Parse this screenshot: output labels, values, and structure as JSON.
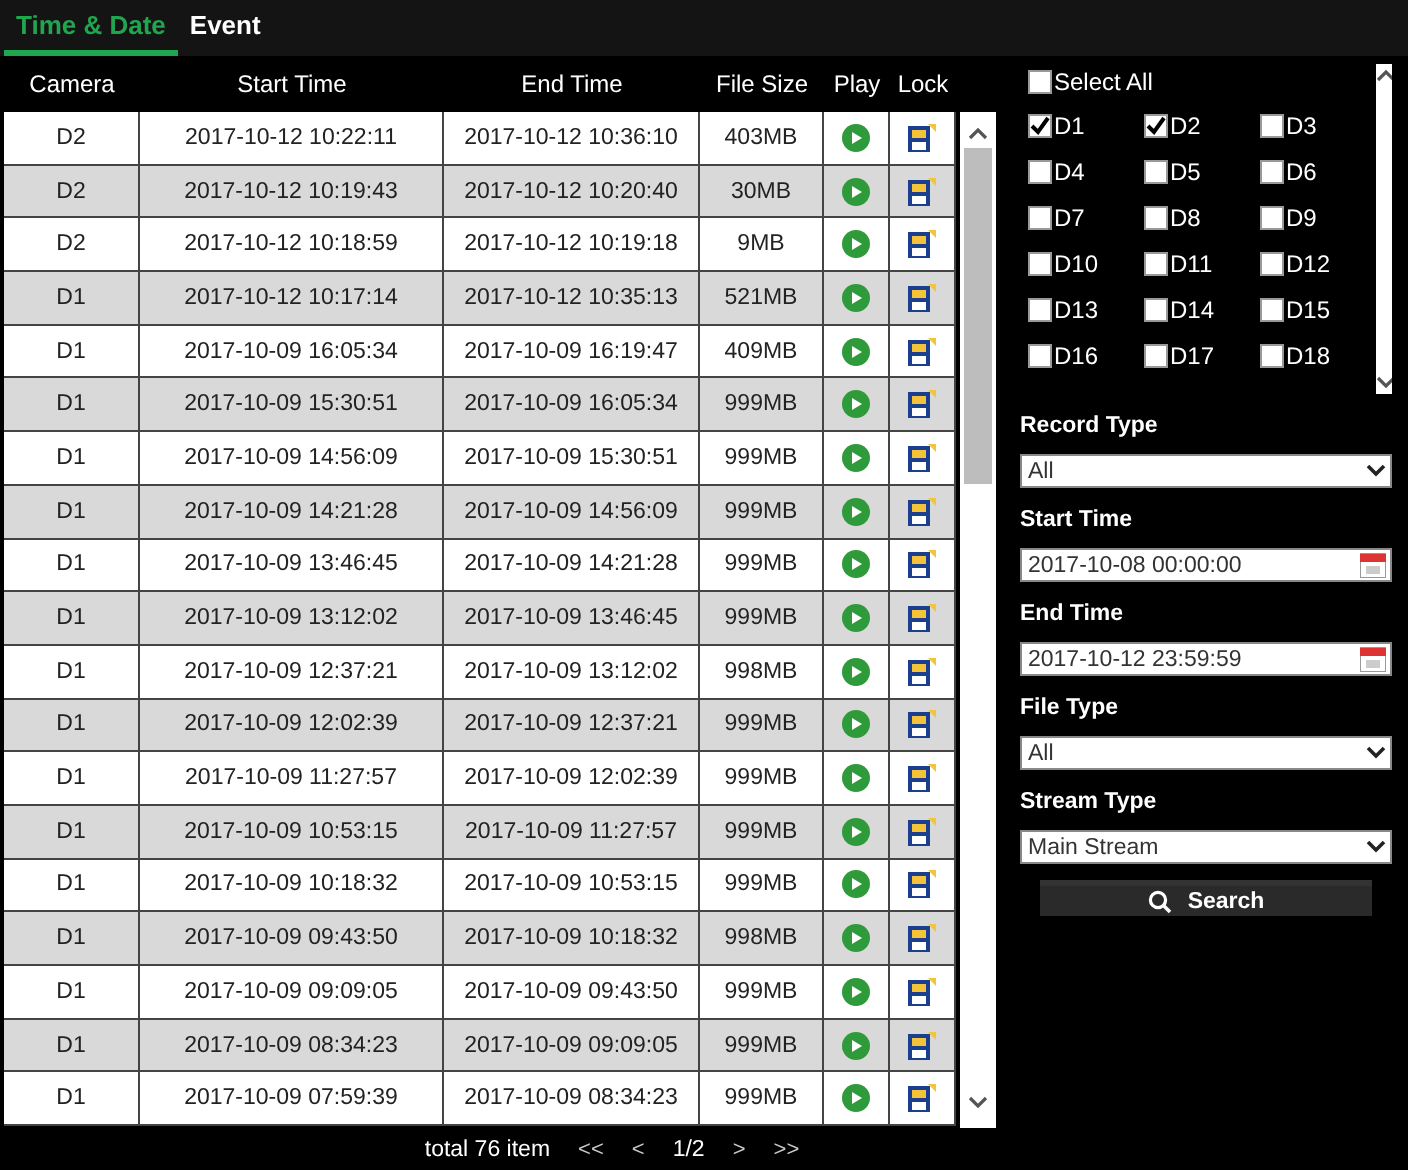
{
  "tabs": [
    {
      "label": "Time & Date",
      "selected": true
    },
    {
      "label": "Event",
      "selected": false
    }
  ],
  "table": {
    "columns": [
      "Camera",
      "Start Time",
      "End Time",
      "File Size",
      "Play",
      "Lock"
    ],
    "rows": [
      {
        "camera": "D2",
        "start": "2017-10-12 10:22:11",
        "end": "2017-10-12 10:36:10",
        "size": "403MB"
      },
      {
        "camera": "D2",
        "start": "2017-10-12 10:19:43",
        "end": "2017-10-12 10:20:40",
        "size": "30MB"
      },
      {
        "camera": "D2",
        "start": "2017-10-12 10:18:59",
        "end": "2017-10-12 10:19:18",
        "size": "9MB"
      },
      {
        "camera": "D1",
        "start": "2017-10-12 10:17:14",
        "end": "2017-10-12 10:35:13",
        "size": "521MB"
      },
      {
        "camera": "D1",
        "start": "2017-10-09 16:05:34",
        "end": "2017-10-09 16:19:47",
        "size": "409MB"
      },
      {
        "camera": "D1",
        "start": "2017-10-09 15:30:51",
        "end": "2017-10-09 16:05:34",
        "size": "999MB"
      },
      {
        "camera": "D1",
        "start": "2017-10-09 14:56:09",
        "end": "2017-10-09 15:30:51",
        "size": "999MB"
      },
      {
        "camera": "D1",
        "start": "2017-10-09 14:21:28",
        "end": "2017-10-09 14:56:09",
        "size": "999MB"
      },
      {
        "camera": "D1",
        "start": "2017-10-09 13:46:45",
        "end": "2017-10-09 14:21:28",
        "size": "999MB"
      },
      {
        "camera": "D1",
        "start": "2017-10-09 13:12:02",
        "end": "2017-10-09 13:46:45",
        "size": "999MB"
      },
      {
        "camera": "D1",
        "start": "2017-10-09 12:37:21",
        "end": "2017-10-09 13:12:02",
        "size": "998MB"
      },
      {
        "camera": "D1",
        "start": "2017-10-09 12:02:39",
        "end": "2017-10-09 12:37:21",
        "size": "999MB"
      },
      {
        "camera": "D1",
        "start": "2017-10-09 11:27:57",
        "end": "2017-10-09 12:02:39",
        "size": "999MB"
      },
      {
        "camera": "D1",
        "start": "2017-10-09 10:53:15",
        "end": "2017-10-09 11:27:57",
        "size": "999MB"
      },
      {
        "camera": "D1",
        "start": "2017-10-09 10:18:32",
        "end": "2017-10-09 10:53:15",
        "size": "999MB"
      },
      {
        "camera": "D1",
        "start": "2017-10-09 09:43:50",
        "end": "2017-10-09 10:18:32",
        "size": "998MB"
      },
      {
        "camera": "D1",
        "start": "2017-10-09 09:09:05",
        "end": "2017-10-09 09:43:50",
        "size": "999MB"
      },
      {
        "camera": "D1",
        "start": "2017-10-09 08:34:23",
        "end": "2017-10-09 09:09:05",
        "size": "999MB"
      },
      {
        "camera": "D1",
        "start": "2017-10-09 07:59:39",
        "end": "2017-10-09 08:34:23",
        "size": "999MB"
      }
    ]
  },
  "pagination": {
    "total": "total 76 item",
    "first": "<<",
    "prev": "<",
    "page": "1/2",
    "next": ">",
    "last": ">>"
  },
  "channels": {
    "select_all": {
      "label": "Select All",
      "checked": false
    },
    "items": [
      {
        "label": "D1",
        "checked": true
      },
      {
        "label": "D2",
        "checked": true
      },
      {
        "label": "D3",
        "checked": false
      },
      {
        "label": "D4",
        "checked": false
      },
      {
        "label": "D5",
        "checked": false
      },
      {
        "label": "D6",
        "checked": false
      },
      {
        "label": "D7",
        "checked": false
      },
      {
        "label": "D8",
        "checked": false
      },
      {
        "label": "D9",
        "checked": false
      },
      {
        "label": "D10",
        "checked": false
      },
      {
        "label": "D11",
        "checked": false
      },
      {
        "label": "D12",
        "checked": false
      },
      {
        "label": "D13",
        "checked": false
      },
      {
        "label": "D14",
        "checked": false
      },
      {
        "label": "D15",
        "checked": false
      },
      {
        "label": "D16",
        "checked": false
      },
      {
        "label": "D17",
        "checked": false
      },
      {
        "label": "D18",
        "checked": false
      }
    ]
  },
  "filters": [
    {
      "kind": "select",
      "label": "Record Type",
      "value": "All"
    },
    {
      "kind": "date",
      "label": "Start Time",
      "value": "2017-10-08 00:00:00"
    },
    {
      "kind": "date",
      "label": "End Time",
      "value": "2017-10-12 23:59:59"
    },
    {
      "kind": "select",
      "label": "File Type",
      "value": "All"
    },
    {
      "kind": "select",
      "label": "Stream Type",
      "value": "Main Stream"
    }
  ],
  "search_button": "Search"
}
